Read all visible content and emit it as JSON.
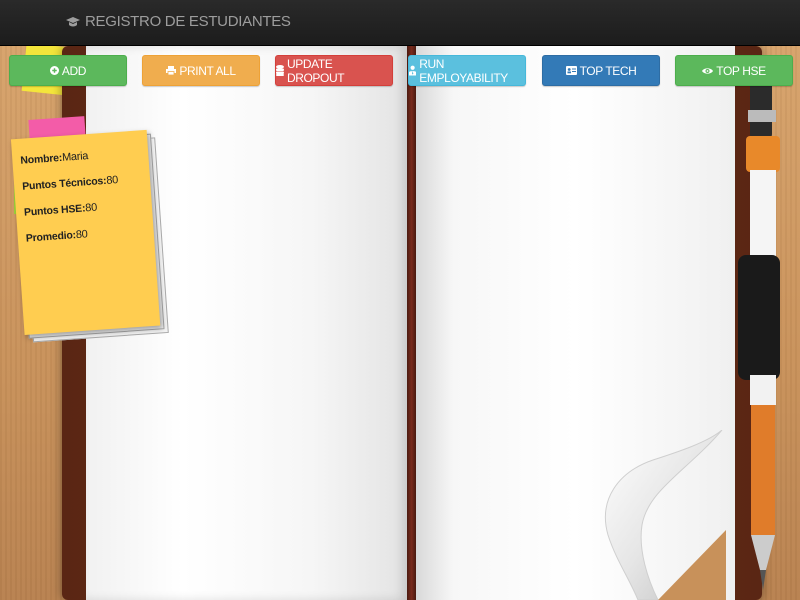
{
  "navbar": {
    "brand": "REGISTRO DE ESTUDIANTES",
    "brand_icon": "graduation-cap-icon"
  },
  "toolbar": {
    "buttons": [
      {
        "label": "ADD",
        "icon": "plus-circle-icon",
        "color": "#5cb85c"
      },
      {
        "label": "PRINT ALL",
        "icon": "print-icon",
        "color": "#f0ad4e"
      },
      {
        "label": "UPDATE DROPOUT",
        "icon": "database-icon",
        "color": "#d9534f"
      },
      {
        "label": "RUN EMPLOYABILITY",
        "icon": "user-tie-icon",
        "color": "#5bc0de"
      },
      {
        "label": "TOP TECH",
        "icon": "id-card-icon",
        "color": "#337ab7"
      },
      {
        "label": "TOP HSE",
        "icon": "eye-icon",
        "color": "#5cb85c"
      }
    ]
  },
  "student_card": {
    "fields": [
      {
        "label": "Nombre:",
        "value": "Maria"
      },
      {
        "label": "Puntos Técnicos:",
        "value": "80"
      },
      {
        "label": "Puntos HSE:",
        "value": "80"
      },
      {
        "label": "Promedio:",
        "value": "80"
      }
    ]
  }
}
